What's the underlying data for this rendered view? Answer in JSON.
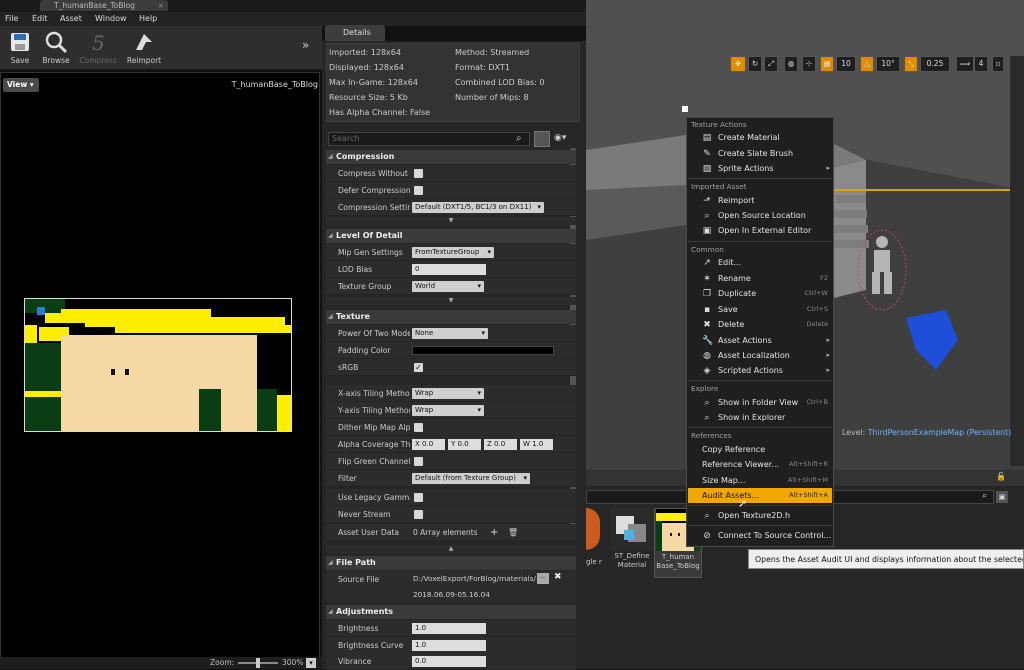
{
  "window": {
    "tab_title": "T_humanBase_ToBlog",
    "tab_close": "×"
  },
  "menu": [
    "File",
    "Edit",
    "Asset",
    "Window",
    "Help"
  ],
  "toolbar": {
    "save": "Save",
    "browse": "Browse",
    "compress": "Compress",
    "reimport": "Reimport",
    "more": "»"
  },
  "viewport": {
    "view_button": "View ▾",
    "texture_name": "T_humanBase_ToBlog",
    "zoom_label": "Zoom:",
    "zoom_value": "300%"
  },
  "details": {
    "tab": "Details",
    "info": {
      "imported": "Imported: 128x64",
      "displayed": "Displayed: 128x64",
      "max_ingame": "Max In-Game: 128x64",
      "resource_size": "Resource Size: 5 Kb",
      "has_alpha": "Has Alpha Channel: False",
      "method": "Method: Streamed",
      "format": "Format: DXT1",
      "lod_bias": "Combined LOD Bias: 0",
      "mips": "Number of Mips: 8"
    },
    "search_placeholder": "Search",
    "sections": {
      "compression": "Compression",
      "lod": "Level Of Detail",
      "texture": "Texture",
      "filepath": "File Path",
      "adjustments": "Adjustments"
    },
    "compression_rows": {
      "compress_without_alpha": "Compress Without Al",
      "defer": "Defer Compression",
      "setting": "Compression Setting",
      "setting_value": "Default (DXT1/5, BC1/3 on DX11)"
    },
    "lod_rows": {
      "mip_gen": "Mip Gen Settings",
      "mip_gen_value": "FromTextureGroup",
      "lod_bias": "LOD Bias",
      "lod_bias_value": "0",
      "texture_group": "Texture Group",
      "texture_group_value": "World"
    },
    "texture_rows": {
      "pow2": "Power Of Two Mode",
      "pow2_value": "None",
      "padding": "Padding Color",
      "srgb": "sRGB",
      "xtiling": "X-axis Tiling Method",
      "xtiling_value": "Wrap",
      "ytiling": "Y-axis Tiling Method",
      "ytiling_value": "Wrap",
      "dither": "Dither Mip Map Alpha",
      "alpha_cov": "Alpha Coverage Thres",
      "alpha_x": "X 0.0",
      "alpha_y": "Y 0.0",
      "alpha_z": "Z 0.0",
      "alpha_w": "W 1.0",
      "flip_green": "Flip Green Channel",
      "filter": "Filter",
      "filter_value": "Default (from Texture Group)",
      "legacy_gamma": "Use Legacy Gamma",
      "never_stream": "Never Stream",
      "user_data": "Asset User Data",
      "user_data_value": "0 Array elements"
    },
    "filepath_rows": {
      "source": "Source File",
      "source_value": "D:/VoxelExport/ForBlog/materials/",
      "timestamp": "2018.06.09-05.16.04"
    },
    "adjust_rows": {
      "brightness": "Brightness",
      "brightness_value": "1.0",
      "brightness_curve": "Brightness Curve",
      "brightness_curve_value": "1.0",
      "vibrance": "Vibrance",
      "vibrance_value": "0.0"
    }
  },
  "scene_toolbar": {
    "grid": "10",
    "angle": "10°",
    "scale": "0.25",
    "cam": "4"
  },
  "context_menu": {
    "sections": {
      "texture_actions": "Texture Actions",
      "imported_asset": "Imported Asset",
      "common": "Common",
      "explore": "Explore",
      "references": "References"
    },
    "items": {
      "create_material": "Create Material",
      "create_slate_brush": "Create Slate Brush",
      "sprite_actions": "Sprite Actions",
      "reimport": "Reimport",
      "open_source_location": "Open Source Location",
      "open_external": "Open In External Editor",
      "edit": "Edit...",
      "rename": "Rename",
      "rename_sc": "F2",
      "duplicate": "Duplicate",
      "duplicate_sc": "Ctrl+W",
      "save": "Save",
      "save_sc": "Ctrl+S",
      "delete": "Delete",
      "delete_sc": "Delete",
      "asset_actions": "Asset Actions",
      "asset_localization": "Asset Localization",
      "scripted_actions": "Scripted Actions",
      "show_folder": "Show in Folder View",
      "show_folder_sc": "Ctrl+B",
      "show_explorer": "Show in Explorer",
      "copy_reference": "Copy Reference",
      "reference_viewer": "Reference Viewer...",
      "reference_viewer_sc": "Alt+Shift+R",
      "size_map": "Size Map...",
      "size_map_sc": "Alt+Shift+M",
      "audit_assets": "Audit Assets...",
      "audit_assets_sc": "Alt+Shift+A",
      "open_header": "Open Texture2D.h",
      "connect_source": "Connect To Source Control..."
    }
  },
  "tooltip": "Opens the Asset Audit UI and displays information about the selected as",
  "level": {
    "prefix": "Level:",
    "name": "ThirdPersonExampleMap (Persistent)"
  },
  "assets": [
    {
      "label": "gle r"
    },
    {
      "label": "ST_Define Material"
    },
    {
      "label": "T_human Base_ToBlog"
    }
  ],
  "colors": {
    "accent": "#f0a800",
    "texture_yellow": "#ffee00",
    "texture_skin": "#f6d9a5",
    "texture_green": "#0b3d14"
  }
}
